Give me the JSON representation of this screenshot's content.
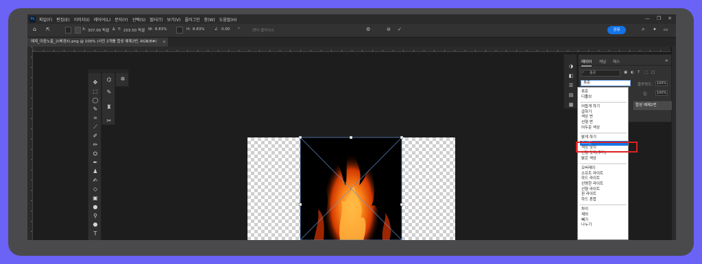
{
  "menubar": {
    "logo": "Ps",
    "items": [
      "파일(F)",
      "편집(E)",
      "이미지(I)",
      "레이어(L)",
      "문자(Y)",
      "선택(S)",
      "필터(T)",
      "보기(V)",
      "플러그인",
      "창(W)",
      "도움말(H)"
    ],
    "window_controls": [
      "—",
      "❐",
      "✕"
    ]
  },
  "options": {
    "x_label": "X:",
    "x_value": "307.00 픽셀",
    "y_label": "Y:",
    "y_value": "203.50 픽셀",
    "w_label": "W:",
    "w_value": "8.83%",
    "h_label": "H:",
    "h_value": "8.83%",
    "angle_value": "0.00",
    "interp_label": "엔터 앨리어스",
    "share_label": "공유"
  },
  "document": {
    "tab_title": "예제_이중노출_2(배경X).png @ 100% (사진 2개를 합성 예제2번, RGB/8#)",
    "tab_close": "×"
  },
  "layers_panel": {
    "tabs": [
      "레이어",
      "채널",
      "패스"
    ],
    "search_placeholder": "종류",
    "blend_mode": "표준",
    "opacity_label": "불투명도:",
    "opacity_value": "100%",
    "fill_label": "칠:",
    "fill_value": "100%",
    "layer_name": "합성 예제2번"
  },
  "blend_dropdown": {
    "groups": [
      [
        "표준",
        "디졸브"
      ],
      [
        "어둡게 하기",
        "곱하기",
        "색상 번",
        "선형 번",
        "어두운 색상"
      ],
      [
        "밝게 하기",
        "스크린",
        "색상 닷지",
        "선형 닷지(추가)",
        "밝은 색상"
      ],
      [
        "오버레이",
        "소프트 라이트",
        "하드 라이트",
        "선명한 라이트",
        "선형 라이트",
        "핀 라이트",
        "하드 혼합"
      ],
      [
        "차이",
        "제외",
        "빼기",
        "나누기"
      ]
    ],
    "highlighted": "스크린"
  },
  "colors": {
    "background": "#6a63f6",
    "accent": "#1473e6",
    "highlight_box": "#e02020"
  }
}
